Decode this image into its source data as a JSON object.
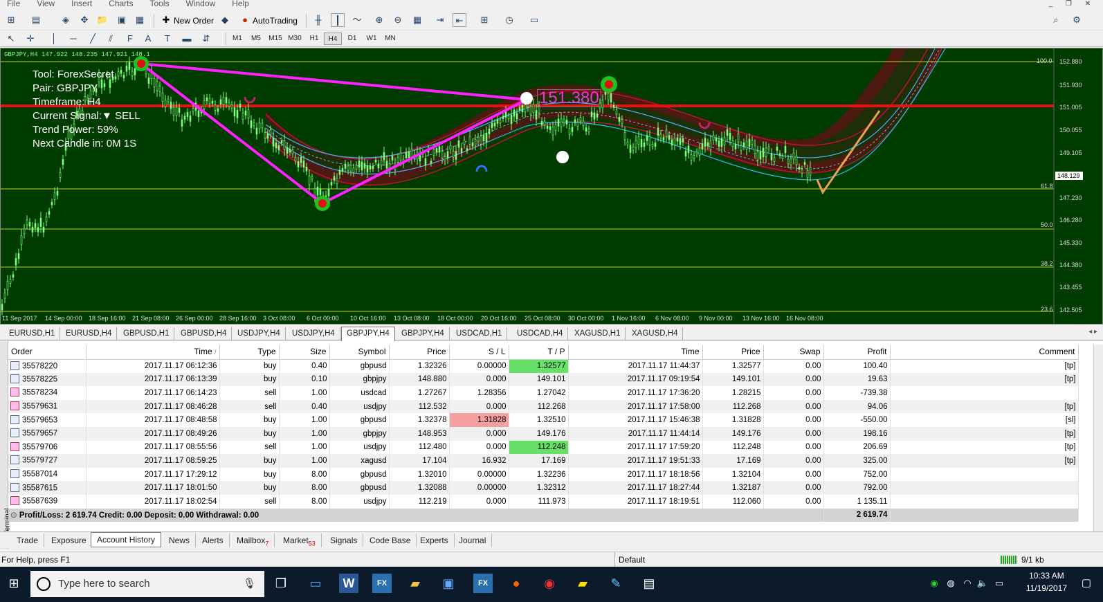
{
  "menu": [
    "File",
    "View",
    "Insert",
    "Charts",
    "Tools",
    "Window",
    "Help"
  ],
  "toolbar": {
    "new_order": "New Order",
    "autotrading": "AutoTrading"
  },
  "timeframes": [
    "M1",
    "M5",
    "M15",
    "M30",
    "H1",
    "H4",
    "D1",
    "W1",
    "MN"
  ],
  "timeframe_selected": "H4",
  "chart": {
    "symbol_line": "GBPJPY,H4  147.922 148.235 147.921 148.1",
    "info": {
      "tool": "Tool: ForexSecret",
      "pair": "Pair: GBPJPY",
      "timeframe": "Timeframe: H4",
      "signal": "Current Signal:▼ SELL",
      "trend": "Trend Power: 59%",
      "next": "Next Candle in: 0M 1S"
    },
    "price_label": "151.380",
    "current_price": "148.129",
    "price_axis": [
      "152.880",
      "151.930",
      "151.005",
      "150.055",
      "149.105",
      "147.230",
      "146.280",
      "145.330",
      "144.380",
      "143.455",
      "142.505"
    ],
    "fib_labels": [
      "100.0",
      "61.8",
      "50.0",
      "38.2",
      "23.6"
    ],
    "dates": [
      "11 Sep 2017",
      "14 Sep 00:00",
      "18 Sep 16:00",
      "21 Sep 08:00",
      "26 Sep 00:00",
      "28 Sep 16:00",
      "3 Oct 08:00",
      "6 Oct 00:00",
      "10 Oct 16:00",
      "13 Oct 08:00",
      "18 Oct 00:00",
      "20 Oct 16:00",
      "25 Oct 08:00",
      "30 Oct 00:00",
      "1 Nov 16:00",
      "6 Nov 08:00",
      "9 Nov 00:00",
      "13 Nov 16:00",
      "16 Nov 08:00"
    ]
  },
  "chart_tabs": [
    "EURUSD,H1",
    "EURUSD,H4",
    "GBPUSD,H1",
    "GBPUSD,H4",
    "USDJPY,H4",
    "USDJPY,H4",
    "GBPJPY,H4",
    "GBPJPY,H4",
    "USDCAD,H1",
    "USDCAD,H4",
    "XAGUSD,H1",
    "XAGUSD,H4"
  ],
  "chart_tab_selected": 6,
  "terminal": {
    "side_label": "Terminal",
    "columns": [
      "Order",
      "Time",
      "/",
      "Type",
      "Size",
      "Symbol",
      "Price",
      "S / L",
      "T / P",
      "Time",
      "Price",
      "Swap",
      "Profit",
      "Comment"
    ],
    "rows": [
      [
        "35578220",
        "2017.11.17 06:12:36",
        "buy",
        "0.40",
        "gbpusd",
        "1.32326",
        "0.00000",
        "1.32577",
        "2017.11.17 11:44:37",
        "1.32577",
        "0.00",
        "100.40",
        "[tp]"
      ],
      [
        "35578225",
        "2017.11.17 06:13:39",
        "buy",
        "0.10",
        "gbpjpy",
        "148.880",
        "0.000",
        "149.101",
        "2017.11.17 09:19:54",
        "149.101",
        "0.00",
        "19.63",
        "[tp]"
      ],
      [
        "35578234",
        "2017.11.17 06:14:23",
        "sell",
        "1.00",
        "usdcad",
        "1.27267",
        "1.28356",
        "1.27042",
        "2017.11.17 17:36:20",
        "1.28215",
        "0.00",
        "-739.38",
        ""
      ],
      [
        "35579631",
        "2017.11.17 08:46:28",
        "sell",
        "0.40",
        "usdjpy",
        "112.532",
        "0.000",
        "112.268",
        "2017.11.17 17:58:00",
        "112.268",
        "0.00",
        "94.06",
        "[tp]"
      ],
      [
        "35579653",
        "2017.11.17 08:48:58",
        "buy",
        "1.00",
        "gbpusd",
        "1.32378",
        "1.31828",
        "1.32510",
        "2017.11.17 15:46:38",
        "1.31828",
        "0.00",
        "-550.00",
        "[sl]"
      ],
      [
        "35579657",
        "2017.11.17 08:49:26",
        "buy",
        "1.00",
        "gbpjpy",
        "148.953",
        "0.000",
        "149.176",
        "2017.11.17 11:44:14",
        "149.176",
        "0.00",
        "198.16",
        "[tp]"
      ],
      [
        "35579706",
        "2017.11.17 08:55:56",
        "sell",
        "1.00",
        "usdjpy",
        "112.480",
        "0.000",
        "112.248",
        "2017.11.17 17:59:20",
        "112.248",
        "0.00",
        "206.69",
        "[tp]"
      ],
      [
        "35579727",
        "2017.11.17 08:59:25",
        "buy",
        "1.00",
        "xagusd",
        "17.104",
        "16.932",
        "17.169",
        "2017.11.17 19:51:33",
        "17.169",
        "0.00",
        "325.00",
        "[tp]"
      ],
      [
        "35587014",
        "2017.11.17 17:29:12",
        "buy",
        "8.00",
        "gbpusd",
        "1.32010",
        "0.00000",
        "1.32236",
        "2017.11.17 18:18:56",
        "1.32104",
        "0.00",
        "752.00",
        ""
      ],
      [
        "35587615",
        "2017.11.17 18:01:50",
        "buy",
        "8.00",
        "gbpusd",
        "1.32088",
        "0.00000",
        "1.32312",
        "2017.11.17 18:27:44",
        "1.32187",
        "0.00",
        "792.00",
        ""
      ],
      [
        "35587639",
        "2017.11.17 18:02:54",
        "sell",
        "8.00",
        "usdjpy",
        "112.219",
        "0.000",
        "111.973",
        "2017.11.17 18:19:51",
        "112.060",
        "0.00",
        "1 135.11",
        ""
      ]
    ],
    "tp_hit": [
      0,
      1,
      3,
      5,
      6,
      7
    ],
    "sl_hit": [
      4
    ],
    "summary": "Profit/Loss: 2 619.74  Credit: 0.00  Deposit: 0.00  Withdrawal: 0.00",
    "summary_total": "2 619.74"
  },
  "terminal_tabs": [
    {
      "label": "Trade"
    },
    {
      "label": "Exposure"
    },
    {
      "label": "Account History"
    },
    {
      "label": "News"
    },
    {
      "label": "Alerts"
    },
    {
      "label": "Mailbox",
      "badge": "7"
    },
    {
      "label": "Market",
      "badge": "53"
    },
    {
      "label": "Signals"
    },
    {
      "label": "Code Base"
    },
    {
      "label": "Experts"
    },
    {
      "label": "Journal"
    }
  ],
  "terminal_tab_selected": 2,
  "status": {
    "help": "For Help, press F1",
    "profile": "Default",
    "traffic": "9/1 kb"
  },
  "taskbar": {
    "search_placeholder": "Type here to search",
    "time": "10:33 AM",
    "date": "11/19/2017",
    "fx_label": "FX"
  }
}
